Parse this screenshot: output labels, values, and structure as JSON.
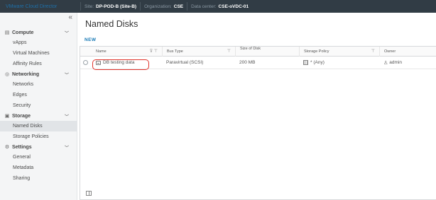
{
  "topbar": {
    "brand": "VMware Cloud Director",
    "context": [
      {
        "key": "Site:",
        "value": "DP-POD-B (Site-B)"
      },
      {
        "key": "Organization:",
        "value": "CSE"
      },
      {
        "key": "Data center:",
        "value": "CSE-oVDC-01"
      }
    ]
  },
  "sidebar": {
    "collapse_glyph": "«",
    "sections": [
      {
        "label": "Compute",
        "icon": "compute-icon",
        "items": [
          "vApps",
          "Virtual Machines",
          "Affinity Rules"
        ]
      },
      {
        "label": "Networking",
        "icon": "networking-icon",
        "items": [
          "Networks",
          "Edges",
          "Security"
        ]
      },
      {
        "label": "Storage",
        "icon": "storage-icon",
        "items": [
          "Named Disks",
          "Storage Policies"
        ]
      },
      {
        "label": "Settings",
        "icon": "settings-icon",
        "items": [
          "General",
          "Metadata",
          "Sharing"
        ]
      }
    ],
    "active_item": "Named Disks"
  },
  "main": {
    "title": "Named Disks",
    "new_button": "NEW",
    "columns": [
      "Name",
      "Bus Type",
      "Size of Disk",
      "Storage Policy",
      "Owner"
    ],
    "rows": [
      {
        "name": "DB testing data",
        "bus_type": "Paravirtual (SCSI)",
        "size": "200 MB",
        "policy": "* (Any)",
        "owner": "admin"
      }
    ],
    "highlight_color": "#e0342c"
  },
  "colors": {
    "topbar": "#313c45",
    "accent": "#1779b5",
    "sidebar_bg": "#f4f5f6"
  }
}
